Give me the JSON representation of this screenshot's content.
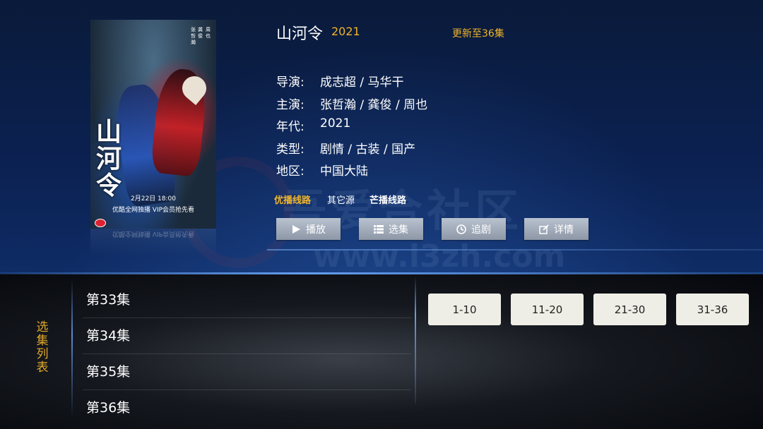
{
  "show": {
    "title": "山河令",
    "year": "2021",
    "update_status": "更新至36集"
  },
  "info": [
    {
      "label": "导演:",
      "value": "成志超 / 马华干"
    },
    {
      "label": "主演:",
      "value": "张哲瀚 / 龚俊 / 周也"
    },
    {
      "label": "年代:",
      "value": "2021"
    },
    {
      "label": "类型:",
      "value": "剧情 / 古装 / 国产"
    },
    {
      "label": "地区:",
      "value": "中国大陆"
    }
  ],
  "sources": [
    "优播线路",
    "其它源",
    "芒播线路"
  ],
  "actions": [
    {
      "label": "播放",
      "icon": "play-icon"
    },
    {
      "label": "选集",
      "icon": "list-icon"
    },
    {
      "label": "追剧",
      "icon": "clock-icon"
    },
    {
      "label": "详情",
      "icon": "edit-icon"
    }
  ],
  "poster": {
    "calligraphy": "山河令",
    "date_text": "2月22日 18:00",
    "promo_text": "优酷全网独播 VIP会员抢先看",
    "side_text_left": "张哲瀚",
    "side_text_right": "龚俊",
    "side_text_far": "周也"
  },
  "episode_panel": {
    "side_label": "选集列表",
    "episodes": [
      "第33集",
      "第34集",
      "第35集",
      "第36集"
    ],
    "ranges": [
      "1-10",
      "11-20",
      "21-30",
      "31-36"
    ]
  },
  "watermark": {
    "text": "吾爱合社区",
    "url": "www.l3zh.com"
  },
  "colors": {
    "accent": "#f0b429",
    "button_bg": "#a5aebb",
    "range_bg": "#eeeee6"
  }
}
